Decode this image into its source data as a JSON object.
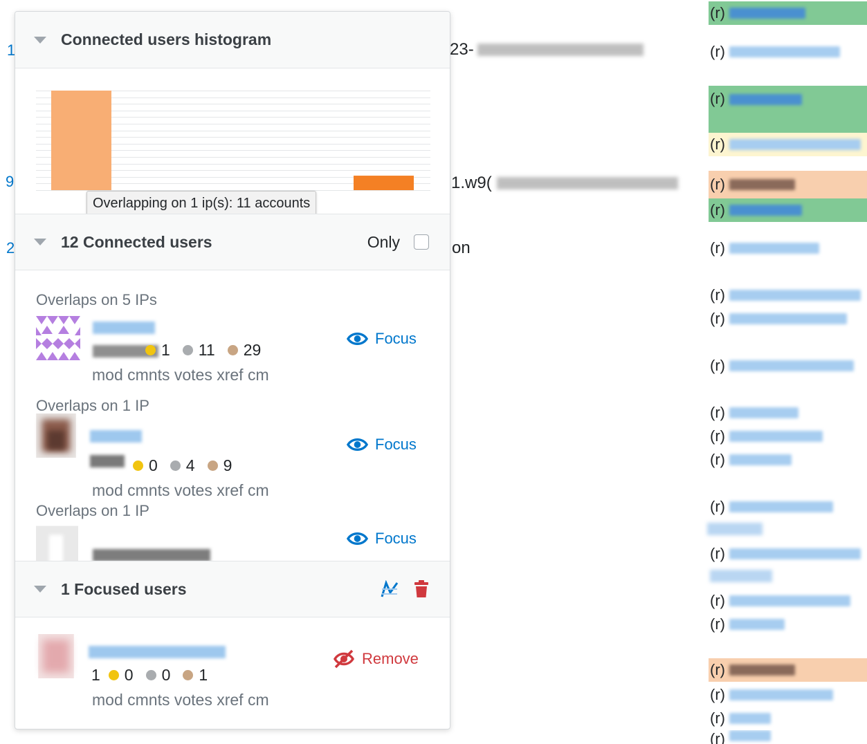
{
  "background": {
    "left_links": [
      "1",
      "9",
      "2"
    ],
    "fragments": {
      "row1_prefix": "23-",
      "row2_prefix": "1.w9(",
      "row3_text": "on"
    },
    "right_column": {
      "prefix": "(r)",
      "highlight_colors": {
        "green": "#81c995",
        "yellow": "#fdf5d0",
        "orange": "#f8cfae"
      }
    }
  },
  "popup": {
    "histogram": {
      "title": "Connected users histogram",
      "tooltip": "Overlapping on 1 ip(s): 11 accounts"
    },
    "connected": {
      "title": "12 Connected users",
      "only_label": "Only",
      "only_checked": false,
      "users": [
        {
          "overlap": "Overlaps on 5 IPs",
          "badges": {
            "gold": "1",
            "silver": "11",
            "bronze": "29"
          },
          "links": "mod cmnts votes xref cm",
          "action": "Focus"
        },
        {
          "overlap": "Overlaps on 1 IP",
          "badges": {
            "gold": "0",
            "silver": "4",
            "bronze": "9"
          },
          "links": "mod cmnts votes xref cm",
          "action": "Focus"
        },
        {
          "overlap": "Overlaps on 1 IP",
          "action": "Focus"
        }
      ]
    },
    "focused": {
      "title": "1 Focused users",
      "icons": [
        "chart-line-icon",
        "trash-icon"
      ],
      "users": [
        {
          "rep": "1",
          "badges": {
            "gold": "0",
            "silver": "0",
            "bronze": "1"
          },
          "links": "mod cmnts votes xref cm",
          "action": "Remove"
        }
      ]
    }
  },
  "chart_data": {
    "type": "bar",
    "title": "",
    "xlabel": "",
    "ylabel": "",
    "grid": true,
    "series": [
      {
        "values": [
          11
        ],
        "color": "#f8ae74"
      },
      {
        "values": [
          1.6
        ],
        "color": "#f48024"
      }
    ],
    "note": "Two bars; first bar (highlighted with tooltip) represents 11 accounts overlapping on 1 ip"
  }
}
